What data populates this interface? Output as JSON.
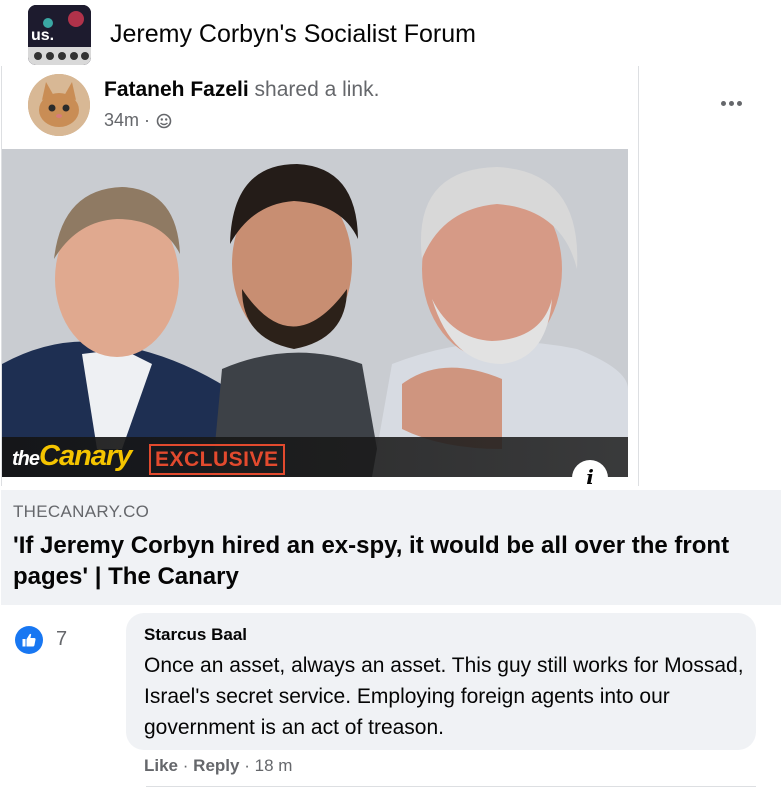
{
  "group": {
    "avatar_text": "us.",
    "title": "Jeremy Corbyn's Socialist Forum"
  },
  "post": {
    "author": "Fataneh Fazeli",
    "action": "shared a link.",
    "time": "34m",
    "separator": "·",
    "audience_icon": "group-audience-icon",
    "more_icon": "more-options-icon"
  },
  "preview": {
    "logo_the": "the",
    "logo_name": "Canary",
    "badge": "EXCLUSIVE",
    "info_icon": "i"
  },
  "link": {
    "domain": "THECANARY.CO",
    "title": "'If Jeremy Corbyn hired an ex-spy, it would be all over the front pages' | The Canary"
  },
  "reactions": {
    "icon": "thumbs-up-icon",
    "count": "7"
  },
  "comment": {
    "author": "Starcus Baal",
    "text": "Once an asset, always an asset. This guy still works for Mossad, Israel's secret service. Employing foreign agents into our government is an act of treason.",
    "like_label": "Like",
    "reply_label": "Reply",
    "dot": "·",
    "time": "18 m"
  },
  "colors": {
    "facebook_blue": "#1877f2",
    "secondary_text": "#65676b",
    "bubble_bg": "#f0f2f5",
    "canary_yellow": "#f4c400",
    "exclusive_red": "#e24a2e"
  }
}
